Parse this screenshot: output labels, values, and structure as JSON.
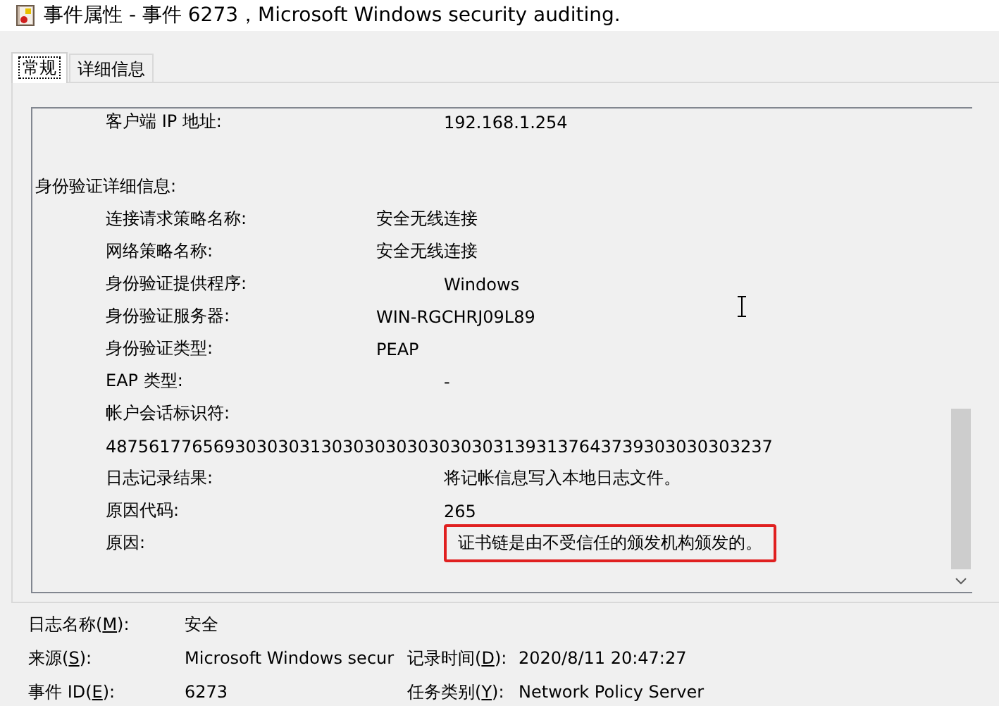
{
  "window": {
    "title": "事件属性 - 事件 6273，Microsoft Windows security auditing."
  },
  "tabs": [
    {
      "label": "常规",
      "selected": true
    },
    {
      "label": "详细信息",
      "selected": false
    }
  ],
  "description": {
    "rows": [
      {
        "kind": "tabbed-field",
        "label": "客户端 IP 地址:",
        "value": "192.168.1.254",
        "highlighted": false
      },
      {
        "kind": "blank"
      },
      {
        "kind": "heading",
        "label": "身份验证详细信息:"
      },
      {
        "kind": "field",
        "label": "连接请求策略名称:",
        "value": "安全无线连接",
        "highlighted": false
      },
      {
        "kind": "field",
        "label": "网络策略名称:",
        "value": "安全无线连接",
        "highlighted": false
      },
      {
        "kind": "tabbed-field",
        "label": "身份验证提供程序:",
        "value": "Windows",
        "highlighted": false
      },
      {
        "kind": "field",
        "label": "身份验证服务器:",
        "value": "WIN-RGCHRJ09L89",
        "highlighted": false
      },
      {
        "kind": "field",
        "label": "身份验证类型:",
        "value": "PEAP",
        "highlighted": false
      },
      {
        "kind": "tabbed-field",
        "label": "EAP 类型:",
        "value": "-",
        "highlighted": false
      },
      {
        "kind": "heading-field",
        "label": "帐户会话标识符:"
      },
      {
        "kind": "line",
        "value": "48756177656930303031303030303030303031393137643739303030303237"
      },
      {
        "kind": "tabbed-field",
        "label": "日志记录结果:",
        "value": "将记帐信息写入本地日志文件。",
        "highlighted": false
      },
      {
        "kind": "tabbed-field",
        "label": "原因代码:",
        "value": "265",
        "highlighted": false
      },
      {
        "kind": "tabbed-field",
        "label": "原因:",
        "value": "证书链是由不受信任的颁发机构颁发的。",
        "highlighted": true
      }
    ]
  },
  "properties": [
    [
      {
        "label": [
          "日志名称(",
          "M",
          "):"
        ],
        "value": "安全"
      }
    ],
    [
      {
        "label": [
          "来源(",
          "S",
          "):"
        ],
        "value": "Microsoft Windows secur"
      },
      {
        "label": [
          "记录时间(",
          "D",
          "):"
        ],
        "value": "2020/8/11 20:47:27"
      }
    ],
    [
      {
        "label": [
          "事件 ID(",
          "E",
          "):"
        ],
        "value": "6273"
      },
      {
        "label": [
          "任务类别(",
          "Y",
          "):"
        ],
        "value": "Network Policy Server"
      }
    ]
  ]
}
